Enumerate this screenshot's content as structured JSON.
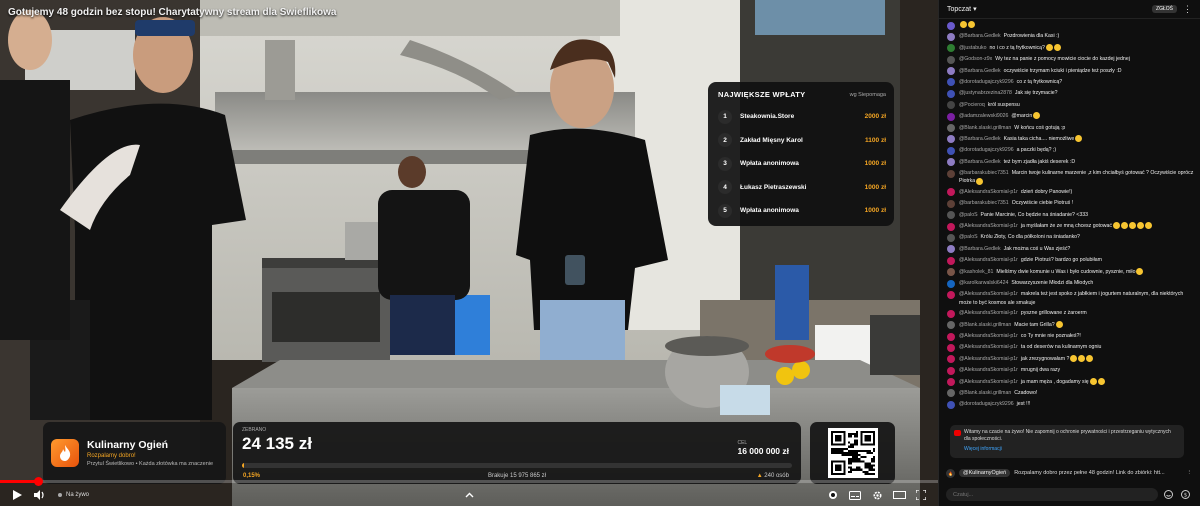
{
  "video": {
    "title": "Gotujemy 48 godzin bez stopu! Charytatywny stream dla Swieflikowa"
  },
  "donations_panel": {
    "title": "NAJWIĘKSZE WPŁATY",
    "subtitle": "wg Siepomaga",
    "items": [
      {
        "rank": "1",
        "name": "Steakownia.Store",
        "amount": "2000 zł"
      },
      {
        "rank": "2",
        "name": "Zakład Mięsny Karol",
        "amount": "1100 zł"
      },
      {
        "rank": "3",
        "name": "Wpłata anonimowa",
        "amount": "1000 zł"
      },
      {
        "rank": "4",
        "name": "Łukasz Pietraszewski",
        "amount": "1000 zł"
      },
      {
        "rank": "5",
        "name": "Wpłata anonimowa",
        "amount": "1000 zł"
      }
    ]
  },
  "brand": {
    "name": "Kulinarny Ogień",
    "tagline": "Rozpalamy dobro!",
    "description": "Przytul Świetlikowo • Każda złotówka ma znaczenie"
  },
  "fundraiser": {
    "collected_label": "ZEBRANO",
    "collected": "24 135 zł",
    "goal_label": "CEL",
    "goal": "16 000 000 zł",
    "progress_percent": 0.15,
    "progress_text": "0,15%",
    "missing": "Brakuje 15 975 865 zł",
    "donors": "240 osób"
  },
  "player": {
    "live_label": "Na żywo",
    "played_fraction": 0.04
  },
  "chat": {
    "header_title": "Topczat",
    "badge": "ZGŁOŚ",
    "messages": [
      {
        "author": "",
        "text": "",
        "emojis": 2,
        "color": "#6a5acd"
      },
      {
        "author": "@Barbara.Gedlek",
        "text": "Pozdrowienia dla Kasi :)",
        "emojis": 0,
        "color": "#8e7cc3"
      },
      {
        "author": "@justabuko",
        "text": "no i co z tą frytkownicą?",
        "emojis": 2,
        "color": "#2e7d32"
      },
      {
        "author": "@Godson-z9x",
        "text": "Wy tez na panie z pomocy mowicie ciocie do kazdej jednej",
        "emojis": 0,
        "color": "#555555"
      },
      {
        "author": "@Barbara.Gedlek",
        "text": "oczywiście trzymam kciuki i pieniądze też poszły :D",
        "emojis": 0,
        "color": "#8e7cc3"
      },
      {
        "author": "@dorotadugajczyk9296",
        "text": "co z tą frytkownicą?",
        "emojis": 0,
        "color": "#3f51b5"
      },
      {
        "author": "@justynabrzezina2878",
        "text": "Jak się trzymacie?",
        "emojis": 0,
        "color": "#3f51b5"
      },
      {
        "author": "@Pocieroq",
        "text": "król suspensu",
        "emojis": 0,
        "color": "#444444"
      },
      {
        "author": "@adamzalewski9026",
        "text": "@marcin",
        "emojis": 1,
        "color": "#7b1fa2"
      },
      {
        "author": "@Blank.slaski.grillman",
        "text": "W końcu coś gotują :p",
        "emojis": 0,
        "color": "#666666"
      },
      {
        "author": "@Barbara.Gedlek",
        "text": "Kasia taka cicha.... niemożliwe",
        "emojis": 1,
        "color": "#8e7cc3"
      },
      {
        "author": "@dorotadugajczyk9296",
        "text": "a paczki będą? ;)",
        "emojis": 0,
        "color": "#3f51b5"
      },
      {
        "author": "@Barbara.Gedlek",
        "text": "też bym zjadła jakiś deserek :D",
        "emojis": 0,
        "color": "#8e7cc3"
      },
      {
        "author": "@barbarakubiec7351",
        "text": "Marcin twoje kulinarne marzenie ,z kim chciałbyś gotować ? Oczywiście oprócz Piotrka",
        "emojis": 1,
        "color": "#5d4037"
      },
      {
        "author": "@AleksandraSkomial-p1r",
        "text": "dzień dobry Panowie!)",
        "emojis": 0,
        "color": "#c2185b"
      },
      {
        "author": "@barbarakubiec7351",
        "text": "Oczywiście ciebie Piotruś !",
        "emojis": 0,
        "color": "#5d4037"
      },
      {
        "author": "@paloS",
        "text": "Panie Marcinie, Co będzie na śniadanie? <333",
        "emojis": 0,
        "color": "#555555"
      },
      {
        "author": "@AleksandraSkomial-p1r",
        "text": "ja myślałam że ze mną chcesz gotować",
        "emojis": 5,
        "color": "#c2185b"
      },
      {
        "author": "@paloS",
        "text": "Królu Złoty, Co dla półkoloni na śniadanko?",
        "emojis": 0,
        "color": "#555555"
      },
      {
        "author": "@Barbara.Gedlek",
        "text": "Jak można coś u Was zjeść?",
        "emojis": 0,
        "color": "#8e7cc3"
      },
      {
        "author": "@AleksandraSkomial-p1r",
        "text": "gdzie Piotruś? bardzo go polubiłam",
        "emojis": 0,
        "color": "#c2185b"
      },
      {
        "author": "@kasholek_81",
        "text": "Mieliśmy dwie komunie u Was i było cudownie, pysznie, miło",
        "emojis": 1,
        "color": "#795548"
      },
      {
        "author": "@karolkarwalski6424",
        "text": "Stowarzyszenie Młodzi dla Młodych",
        "emojis": 0,
        "color": "#1565c0"
      },
      {
        "author": "@AleksandraSkomial-p1r",
        "text": "makrela też jest spoko z jabłkiem i jogurtem naturalnym, dla niektórych może to być kosmos ale smakuje",
        "emojis": 0,
        "color": "#c2185b"
      },
      {
        "author": "@AleksandraSkomial-p1r",
        "text": "pyszne grillowane z żaroerm",
        "emojis": 0,
        "color": "#c2185b"
      },
      {
        "author": "@Blank.slaski.grillman",
        "text": "Macie tam Grilla?",
        "emojis": 1,
        "color": "#666666"
      },
      {
        "author": "@AleksandraSkomial-p1r",
        "text": "co Ty mnie nie poznałeś?!",
        "emojis": 0,
        "color": "#c2185b"
      },
      {
        "author": "@AleksandraSkomial-p1r",
        "text": "ta od deserów na kulinarnym ogniu",
        "emojis": 0,
        "color": "#c2185b"
      },
      {
        "author": "@AleksandraSkomial-p1r",
        "text": "jak zrezygnowałam ?",
        "emojis": 3,
        "color": "#c2185b"
      },
      {
        "author": "@AleksandraSkomial-p1r",
        "text": "mrugnij dwa razy",
        "emojis": 0,
        "color": "#c2185b"
      },
      {
        "author": "@AleksandraSkomial-p1r",
        "text": "ja mam męża , dogadamy się",
        "emojis": 2,
        "color": "#c2185b"
      },
      {
        "author": "@Blank.slaski.grillman",
        "text": "Czadowo!",
        "emojis": 0,
        "color": "#666666"
      },
      {
        "author": "@dorotadugajczyk9296",
        "text": "jest !!!",
        "emojis": 0,
        "color": "#3f51b5"
      }
    ],
    "pinned": {
      "text": "Witamy na czacie na żywo! Nie zapomnij o ochronie prywatności i przestrzeganiu wytycznych dla społeczności.",
      "link": "Więcej informacji"
    },
    "banner": {
      "channel": "@KulinarnyOgień",
      "text": "Rozpalamy dobro przez pełne 48 godzin! Link do zbiórki: htt..."
    },
    "input_placeholder": "Czatuj..."
  },
  "colors": {
    "accent": "#f5a623",
    "live_red": "#ff0000"
  }
}
